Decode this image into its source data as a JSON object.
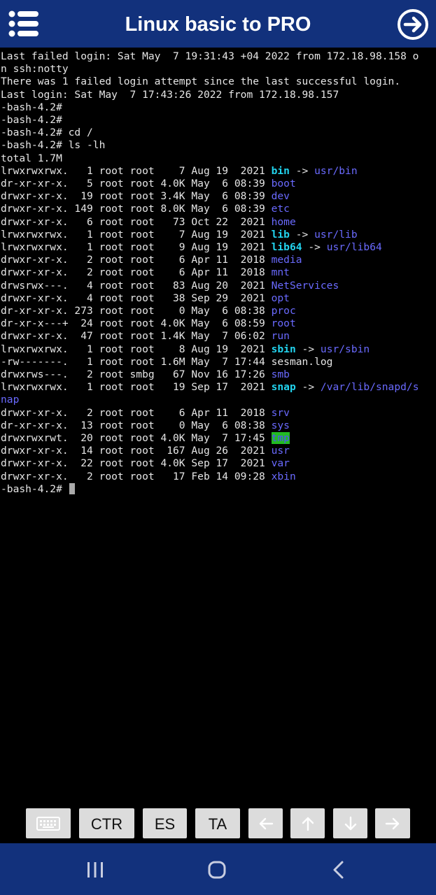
{
  "app": {
    "title": "Linux basic to PRO",
    "menu_icon": "hamburger-list-icon",
    "next_icon": "arrow-right-circle-icon",
    "bar_color": "#12317c"
  },
  "terminal": {
    "lines": [
      [
        {
          "t": "Last failed login: Sat May  7 19:31:43 +04 2022 from 172.18.98.158 o"
        }
      ],
      [
        {
          "t": "n ssh:notty"
        }
      ],
      [
        {
          "t": "There was 1 failed login attempt since the last successful login."
        }
      ],
      [
        {
          "t": "Last login: Sat May  7 17:43:26 2022 from 172.18.98.157"
        }
      ],
      [
        {
          "t": "-bash-4.2#"
        }
      ],
      [
        {
          "t": "-bash-4.2#"
        }
      ],
      [
        {
          "t": "-bash-4.2# cd /"
        }
      ],
      [
        {
          "t": "-bash-4.2# ls -lh"
        }
      ],
      [
        {
          "t": "total 1.7M"
        }
      ],
      [
        {
          "t": "lrwxrwxrwx.   1 root root    7 Aug 19  2021 "
        },
        {
          "t": "bin",
          "c": "cyan"
        },
        {
          "t": " -> "
        },
        {
          "t": "usr/bin",
          "c": "blue"
        }
      ],
      [
        {
          "t": "dr-xr-xr-x.   5 root root 4.0K May  6 08:39 "
        },
        {
          "t": "boot",
          "c": "blue"
        }
      ],
      [
        {
          "t": "drwxr-xr-x.  19 root root 3.4K May  6 08:39 "
        },
        {
          "t": "dev",
          "c": "blue"
        }
      ],
      [
        {
          "t": "drwxr-xr-x. 149 root root 8.0K May  6 08:39 "
        },
        {
          "t": "etc",
          "c": "blue"
        }
      ],
      [
        {
          "t": "drwxr-xr-x.   6 root root   73 Oct 22  2021 "
        },
        {
          "t": "home",
          "c": "blue"
        }
      ],
      [
        {
          "t": "lrwxrwxrwx.   1 root root    7 Aug 19  2021 "
        },
        {
          "t": "lib",
          "c": "cyan"
        },
        {
          "t": " -> "
        },
        {
          "t": "usr/lib",
          "c": "blue"
        }
      ],
      [
        {
          "t": "lrwxrwxrwx.   1 root root    9 Aug 19  2021 "
        },
        {
          "t": "lib64",
          "c": "cyan"
        },
        {
          "t": " -> "
        },
        {
          "t": "usr/lib64",
          "c": "blue"
        }
      ],
      [
        {
          "t": "drwxr-xr-x.   2 root root    6 Apr 11  2018 "
        },
        {
          "t": "media",
          "c": "blue"
        }
      ],
      [
        {
          "t": "drwxr-xr-x.   2 root root    6 Apr 11  2018 "
        },
        {
          "t": "mnt",
          "c": "blue"
        }
      ],
      [
        {
          "t": "drwsrwx---.   4 root root   83 Aug 20  2021 "
        },
        {
          "t": "NetServices",
          "c": "blue"
        }
      ],
      [
        {
          "t": "drwxr-xr-x.   4 root root   38 Sep 29  2021 "
        },
        {
          "t": "opt",
          "c": "blue"
        }
      ],
      [
        {
          "t": "dr-xr-xr-x. 273 root root    0 May  6 08:38 "
        },
        {
          "t": "proc",
          "c": "blue"
        }
      ],
      [
        {
          "t": "dr-xr-x---+  24 root root 4.0K May  6 08:59 "
        },
        {
          "t": "root",
          "c": "blue"
        }
      ],
      [
        {
          "t": "drwxr-xr-x.  47 root root 1.4K May  7 06:02 "
        },
        {
          "t": "run",
          "c": "blue"
        }
      ],
      [
        {
          "t": "lrwxrwxrwx.   1 root root    8 Aug 19  2021 "
        },
        {
          "t": "sbin",
          "c": "cyan"
        },
        {
          "t": " -> "
        },
        {
          "t": "usr/sbin",
          "c": "blue"
        }
      ],
      [
        {
          "t": "-rw-------.   1 root root 1.6M May  7 17:44 sesman.log"
        }
      ],
      [
        {
          "t": "drwxrws---.   2 root smbg   67 Nov 16 17:26 "
        },
        {
          "t": "smb",
          "c": "blue"
        }
      ],
      [
        {
          "t": "lrwxrwxrwx.   1 root root   19 Sep 17  2021 "
        },
        {
          "t": "snap",
          "c": "cyan"
        },
        {
          "t": " -> "
        },
        {
          "t": "/var/lib/snapd/s",
          "c": "blue"
        }
      ],
      [
        {
          "t": "nap",
          "c": "blue"
        }
      ],
      [
        {
          "t": "drwxr-xr-x.   2 root root    6 Apr 11  2018 "
        },
        {
          "t": "srv",
          "c": "blue"
        }
      ],
      [
        {
          "t": "dr-xr-xr-x.  13 root root    0 May  6 08:38 "
        },
        {
          "t": "sys",
          "c": "blue"
        }
      ],
      [
        {
          "t": "drwxrwxrwt.  20 root root 4.0K May  7 17:45 "
        },
        {
          "t": "tmp",
          "c": "tmp"
        }
      ],
      [
        {
          "t": "drwxr-xr-x.  14 root root  167 Aug 26  2021 "
        },
        {
          "t": "usr",
          "c": "blue"
        }
      ],
      [
        {
          "t": "drwxr-xr-x.  22 root root 4.0K Sep 17  2021 "
        },
        {
          "t": "var",
          "c": "blue"
        }
      ],
      [
        {
          "t": "drwxr-xr-x.   2 root root   17 Feb 14 09:28 "
        },
        {
          "t": "xbin",
          "c": "blue"
        }
      ]
    ],
    "prompt": "-bash-4.2# "
  },
  "keys": {
    "keyboard_icon": "keyboard-icon",
    "ctr_label": "CTR",
    "es_label": "ES",
    "ta_label": "TA",
    "left_icon": "arrow-left-icon",
    "up_icon": "arrow-up-icon",
    "down_icon": "arrow-down-icon",
    "right_icon": "arrow-right-icon"
  },
  "navbar": {
    "recents_icon": "recent-apps-icon",
    "home_icon": "home-icon",
    "back_icon": "back-icon"
  }
}
